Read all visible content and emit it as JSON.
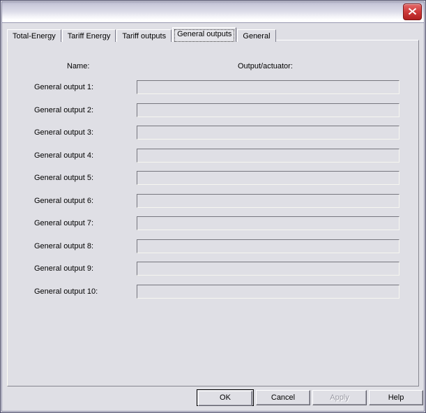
{
  "window": {
    "close_icon": "close-icon"
  },
  "tabs": [
    {
      "label": "Total-Energy",
      "selected": false
    },
    {
      "label": "Tariff Energy",
      "selected": false
    },
    {
      "label": "Tariff outputs",
      "selected": false
    },
    {
      "label": "General outputs",
      "selected": true
    },
    {
      "label": "General",
      "selected": false
    }
  ],
  "panel": {
    "columns": {
      "name": "Name:",
      "output": "Output/actuator:"
    },
    "rows": [
      {
        "label": "General output 1:",
        "value": "",
        "placeholder": ""
      },
      {
        "label": "General output 2:",
        "value": "",
        "placeholder": ""
      },
      {
        "label": "General output 3:",
        "value": "",
        "placeholder": ""
      },
      {
        "label": "General output 4:",
        "value": "",
        "placeholder": ""
      },
      {
        "label": "General output 5:",
        "value": "",
        "placeholder": ""
      },
      {
        "label": "General output 6:",
        "value": "",
        "placeholder": ""
      },
      {
        "label": "General output 7:",
        "value": "",
        "placeholder": ""
      },
      {
        "label": "General output 8:",
        "value": "",
        "placeholder": ""
      },
      {
        "label": "General output 9:",
        "value": "",
        "placeholder": ""
      },
      {
        "label": "General output 10:",
        "value": "",
        "placeholder": ""
      }
    ]
  },
  "buttons": {
    "ok": "OK",
    "cancel": "Cancel",
    "apply": "Apply",
    "help": "Help"
  },
  "colors": {
    "dialog_face": "#dfdfe5",
    "close_button_red": "#cf3b3b",
    "disabled_text": "#9a9aa4",
    "frame_border": "#4a4a68"
  }
}
